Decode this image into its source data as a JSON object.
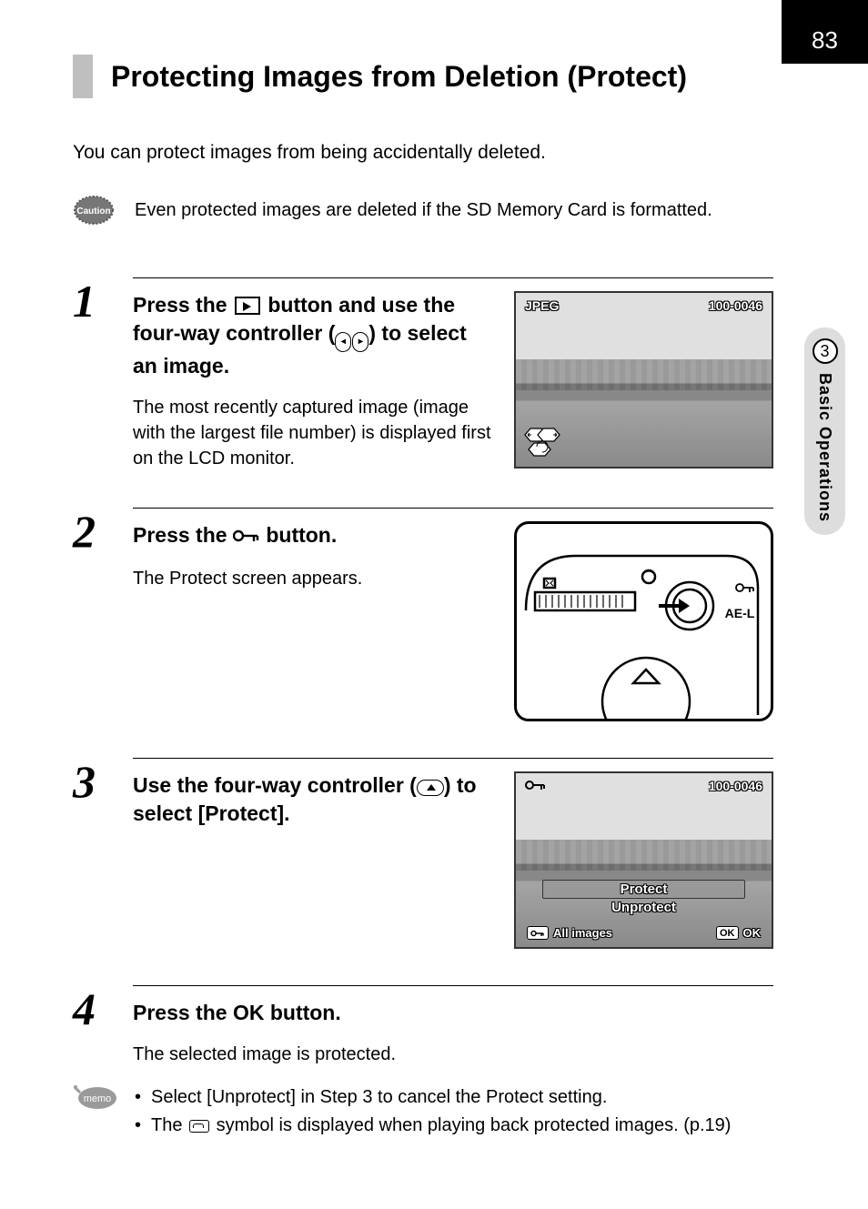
{
  "page_number": "83",
  "side_tab": {
    "chapter_number": "3",
    "chapter_title": "Basic Operations"
  },
  "title": "Protecting Images from Deletion (Protect)",
  "intro": "You can protect images from being accidentally deleted.",
  "caution": "Even protected images are deleted if the SD Memory Card is formatted.",
  "caution_label": "Caution",
  "step1": {
    "heading_pre": "Press the ",
    "heading_mid": " button and use the four-way controller (",
    "heading_post": ") to select an image.",
    "desc": "The most recently captured image (image with the largest file number) is displayed first on the LCD monitor.",
    "lcd": {
      "format": "JPEG",
      "file_no": "100-0046"
    }
  },
  "step2": {
    "heading_pre": "Press the ",
    "heading_post": " button.",
    "desc": "The Protect screen appears.",
    "diagram_label": "AE-L"
  },
  "step3": {
    "heading_pre": "Use the four-way controller (",
    "heading_post": ") to select [Protect].",
    "lcd": {
      "file_no": "100-0046",
      "menu_selected": "Protect",
      "menu_other": "Unprotect",
      "bottom_left": "All images",
      "bottom_right": "OK",
      "ok_badge": "OK"
    }
  },
  "step4": {
    "heading_pre": "Press the ",
    "heading_ok": "OK",
    "heading_post": " button.",
    "desc": "The selected image is protected."
  },
  "memo_label": "memo",
  "memo": {
    "item1": "Select [Unprotect] in Step 3 to cancel the Protect setting.",
    "item2_pre": "The ",
    "item2_post": " symbol is displayed when playing back protected images. (p.19)"
  }
}
